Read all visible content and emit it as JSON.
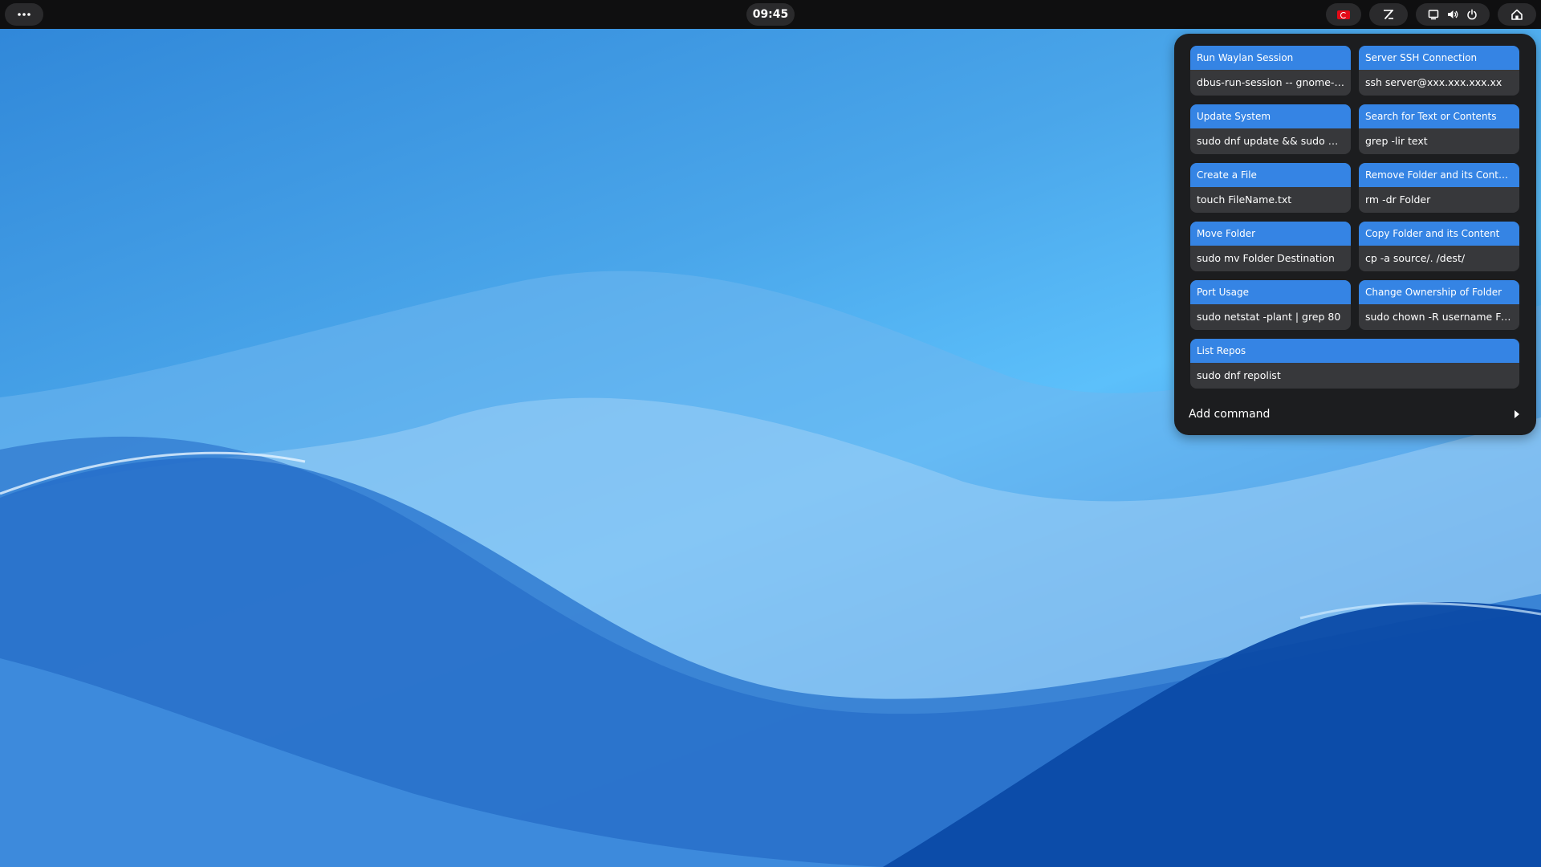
{
  "topbar": {
    "activities_icon": "dots-icon",
    "clock": "09:45",
    "flag_icon": "turkey-flag-icon",
    "command_icon": "terminal-command-icon",
    "status_icons": [
      "display-icon",
      "volume-icon",
      "power-icon"
    ],
    "home_icon": "home-icon"
  },
  "commands": [
    {
      "title": "Run Waylan Session",
      "command": "dbus-run-session -- gnome-s..."
    },
    {
      "title": "Server SSH Connection",
      "command": "ssh server@xxx.xxx.xxx.xx"
    },
    {
      "title": "Update System",
      "command": "sudo dnf update && sudo dnf ..."
    },
    {
      "title": "Search for Text or Contents",
      "command": "grep -lir text"
    },
    {
      "title": "Create a File",
      "command": "touch FileName.txt"
    },
    {
      "title": "Remove Folder and its Content",
      "command": "rm -dr Folder"
    },
    {
      "title": "Move Folder",
      "command": "sudo mv Folder Destination"
    },
    {
      "title": "Copy Folder and its Content",
      "command": "cp -a source/. /dest/"
    },
    {
      "title": "Port Usage",
      "command": "sudo netstat -plant | grep 80"
    },
    {
      "title": "Change Ownership of Folder",
      "command": "sudo chown -R username Fol..."
    },
    {
      "title": "List Repos",
      "command": "sudo dnf repolist"
    }
  ],
  "add_command_label": "Add command",
  "colors": {
    "accent": "#3584e4",
    "topbar": "#0f0f10",
    "popup": "#1c1d1f",
    "card": "#37383b"
  }
}
